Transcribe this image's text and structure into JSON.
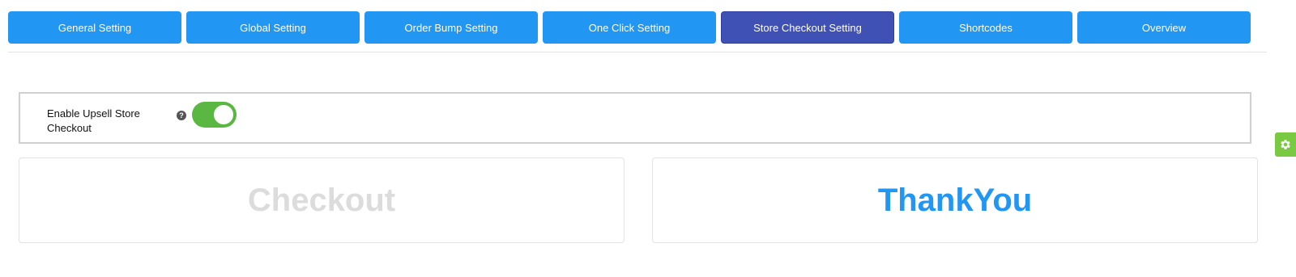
{
  "tabs": [
    {
      "label": "General Setting",
      "active": false
    },
    {
      "label": "Global Setting",
      "active": false
    },
    {
      "label": "Order Bump Setting",
      "active": false
    },
    {
      "label": "One Click Setting",
      "active": false
    },
    {
      "label": "Store Checkout Setting",
      "active": true
    },
    {
      "label": "Shortcodes",
      "active": false
    },
    {
      "label": "Overview",
      "active": false
    }
  ],
  "setting": {
    "label": "Enable Upsell Store Checkout",
    "help_icon": "?",
    "toggle_on": true
  },
  "cards": {
    "checkout": "Checkout",
    "thankyou": "ThankYou"
  },
  "colors": {
    "tab": "#2196f3",
    "tab_active": "#3f51b5",
    "toggle_on": "#5ab842",
    "gear": "#7ac943",
    "thankyou_title": "#2196f3",
    "checkout_title": "#dcdcdc"
  },
  "icons": {
    "help": "question-circle-icon",
    "gear": "gear-icon"
  }
}
